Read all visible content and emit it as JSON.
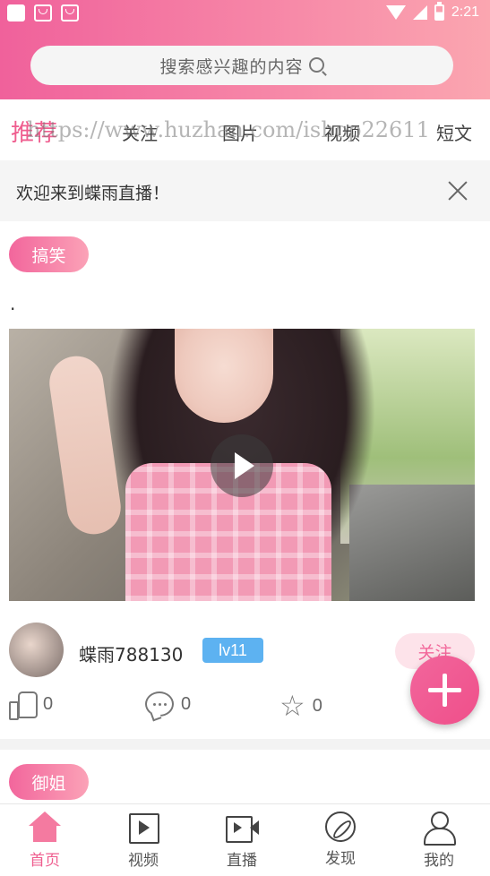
{
  "status_bar": {
    "time": "2:21"
  },
  "search": {
    "placeholder": "搜索感兴趣的内容"
  },
  "tabs": [
    {
      "label": "推荐",
      "active": true
    },
    {
      "label": "关注"
    },
    {
      "label": "图片"
    },
    {
      "label": "视频"
    },
    {
      "label": "短文"
    }
  ],
  "watermark": "https://www.huzhan.com/ishop22611",
  "notice": {
    "text": "欢迎来到蝶雨直播！"
  },
  "post": {
    "tag": "搞笑",
    "text": ".",
    "username": "蝶雨788130",
    "level": "lv11",
    "follow_label": "关注",
    "likes": "0",
    "comments": "0",
    "favorites": "0"
  },
  "post2": {
    "tag": "御姐"
  },
  "bottom_nav": [
    {
      "label": "首页",
      "icon": "home-icon",
      "active": true
    },
    {
      "label": "视频",
      "icon": "video-icon"
    },
    {
      "label": "直播",
      "icon": "live-icon"
    },
    {
      "label": "发现",
      "icon": "discover-icon"
    },
    {
      "label": "我的",
      "icon": "profile-icon"
    }
  ],
  "colors": {
    "accent": "#ef5e8f",
    "level_badge": "#5db2f1"
  }
}
